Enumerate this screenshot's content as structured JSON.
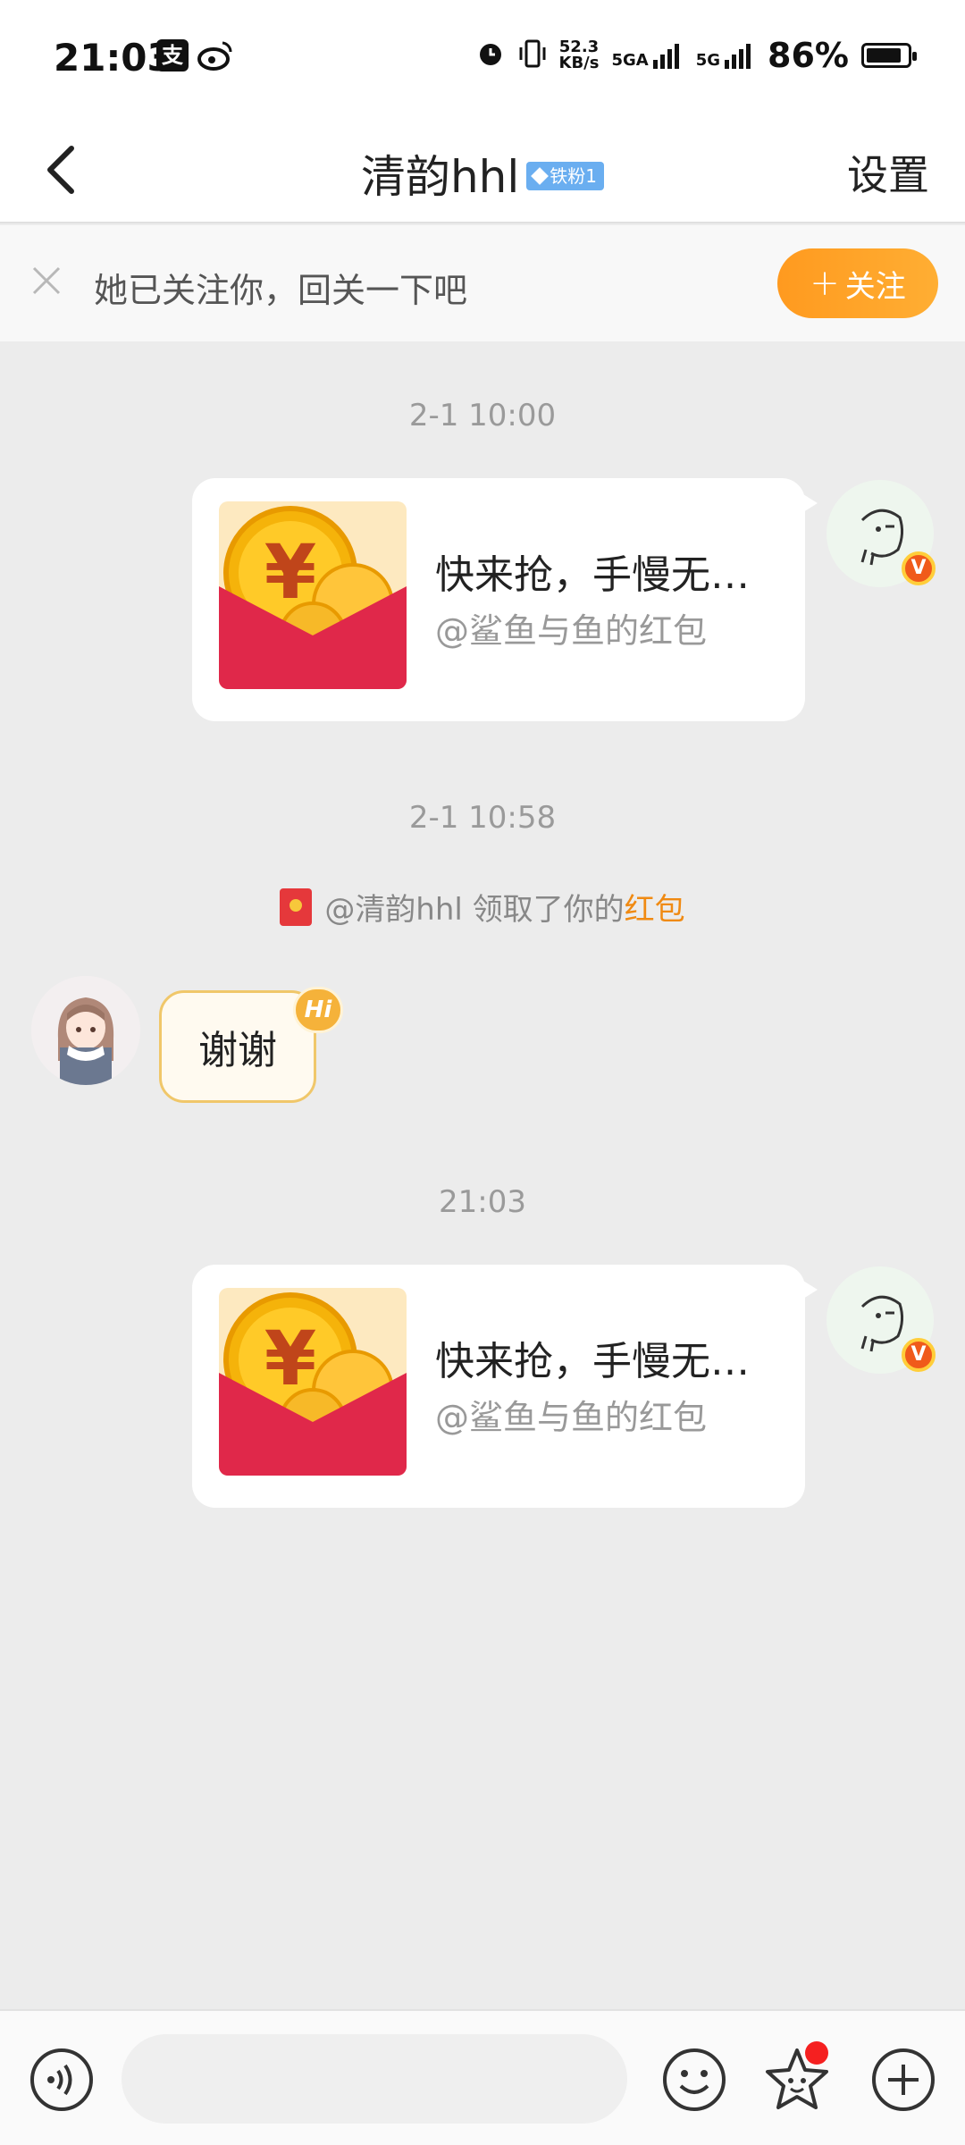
{
  "status_bar": {
    "time": "21:03",
    "app_icons": [
      "pay-icon",
      "weibo-icon"
    ],
    "net_speed_value": "52.3",
    "net_speed_unit": "KB/s",
    "signal1_label": "5GA",
    "signal2_label": "5G",
    "battery_text": "86%",
    "battery_level": 86
  },
  "header": {
    "title": "清韵hhl",
    "badge": "铁粉1",
    "settings_label": "设置"
  },
  "follow_banner": {
    "text": "她已关注你，回关一下吧",
    "button_label": "关注",
    "button_color": "#ff9a1f"
  },
  "messages": {
    "ts1": "2-1 10:00",
    "card1": {
      "title": "快来抢，手慢无…",
      "subtitle": "@鲨鱼与鱼的红包"
    },
    "ts2": "2-1 10:58",
    "notice": {
      "prefix": "@清韵hhl 领取了你的",
      "highlight": "红包"
    },
    "reply": {
      "text": "谢谢",
      "tag": "Hi"
    },
    "ts3": "21:03",
    "card2": {
      "title": "快来抢，手慢无…",
      "subtitle": "@鲨鱼与鱼的红包"
    }
  },
  "input": {
    "placeholder": ""
  },
  "colors": {
    "accent": "#ff9a1f",
    "red_packet": "#e5383b",
    "highlight": "#f08a12",
    "background": "#ececec"
  }
}
